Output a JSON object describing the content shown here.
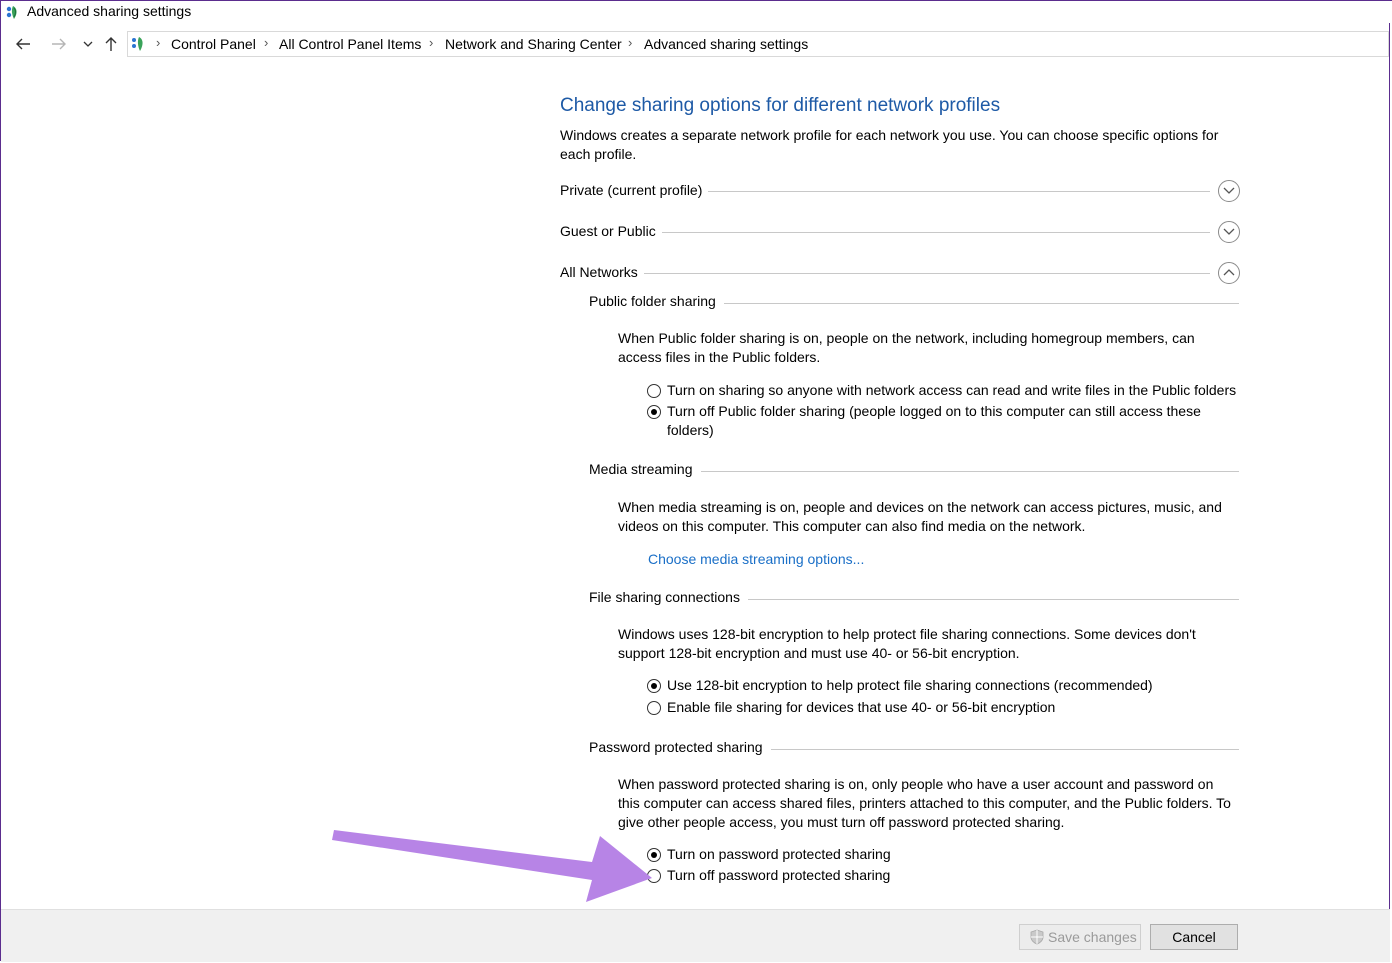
{
  "window": {
    "title": "Advanced sharing settings"
  },
  "address_bar": {
    "breadcrumbs": [
      "Control Panel",
      "All Control Panel Items",
      "Network and Sharing Center",
      "Advanced sharing settings"
    ]
  },
  "main": {
    "heading": "Change sharing options for different network profiles",
    "description": "Windows creates a separate network profile for each network you use. You can choose specific options for each profile.",
    "profiles": [
      {
        "label": "Private (current profile)",
        "expanded": false
      },
      {
        "label": "Guest or Public",
        "expanded": false
      },
      {
        "label": "All Networks",
        "expanded": true
      }
    ],
    "sections": {
      "public_folder": {
        "title": "Public folder sharing",
        "description": "When Public folder sharing is on, people on the network, including homegroup members, can access files in the Public folders.",
        "options": [
          {
            "label": "Turn on sharing so anyone with network access can read and write files in the Public folders",
            "selected": false
          },
          {
            "label": "Turn off Public folder sharing (people logged on to this computer can still access these folders)",
            "selected": true
          }
        ]
      },
      "media_streaming": {
        "title": "Media streaming",
        "description": "When media streaming is on, people and devices on the network can access pictures, music, and videos on this computer. This computer can also find media on the network.",
        "link": "Choose media streaming options..."
      },
      "file_sharing": {
        "title": "File sharing connections",
        "description": "Windows uses 128-bit encryption to help protect file sharing connections. Some devices don't support 128-bit encryption and must use 40- or 56-bit encryption.",
        "options": [
          {
            "label": "Use 128-bit encryption to help protect file sharing connections (recommended)",
            "selected": true
          },
          {
            "label": "Enable file sharing for devices that use 40- or 56-bit encryption",
            "selected": false
          }
        ]
      },
      "password": {
        "title": "Password protected sharing",
        "description": "When password protected sharing is on, only people who have a user account and password on this computer can access shared files, printers attached to this computer, and the Public folders. To give other people access, you must turn off password protected sharing.",
        "options": [
          {
            "label": "Turn on password protected sharing",
            "selected": true
          },
          {
            "label": "Turn off password protected sharing",
            "selected": false
          }
        ]
      }
    }
  },
  "footer": {
    "save_label": "Save changes",
    "cancel_label": "Cancel"
  },
  "colors": {
    "heading": "#1e5aa6",
    "link": "#1a6fc7",
    "annotation_arrow": "#b784e6"
  }
}
